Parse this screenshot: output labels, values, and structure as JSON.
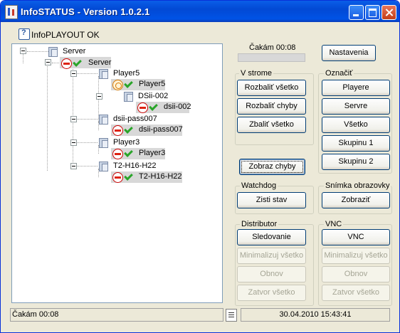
{
  "window": {
    "title": "InfoSTATUS - Version 1.0.2.1"
  },
  "playout_status": "InfoPLAYOUT OK",
  "tree": [
    {
      "label": "Server",
      "kind": "group"
    },
    {
      "label": "Server",
      "kind": "item",
      "status": "ok"
    },
    {
      "label": "Player5",
      "kind": "group"
    },
    {
      "label": "Player5",
      "kind": "item",
      "status": "warning"
    },
    {
      "label": "DSii-002",
      "kind": "group"
    },
    {
      "label": "dsii-002",
      "kind": "item",
      "status": "ok"
    },
    {
      "label": "dsii-pass007",
      "kind": "group"
    },
    {
      "label": "dsii-pass007",
      "kind": "item",
      "status": "ok"
    },
    {
      "label": "Player3",
      "kind": "group"
    },
    {
      "label": "Player3",
      "kind": "item",
      "status": "ok"
    },
    {
      "label": "T2-H16-H22",
      "kind": "group"
    },
    {
      "label": "T2-H16-H22",
      "kind": "item",
      "status": "ok"
    }
  ],
  "wait_label_top": "Čakám 00:08",
  "buttons": {
    "settings": "Nastavenia",
    "show_errors": "Zobraz chyby"
  },
  "groups": {
    "tree": {
      "title": "V strome",
      "buttons": [
        "Rozbaliť všetko",
        "Rozbaliť chyby",
        "Zbaliť všetko"
      ]
    },
    "mark": {
      "title": "Označiť",
      "buttons": [
        "Playere",
        "Servre",
        "Všetko",
        "Skupinu 1",
        "Skupinu 2"
      ]
    },
    "watchdog": {
      "title": "Watchdog",
      "buttons": [
        "Zisti stav"
      ]
    },
    "screenshot": {
      "title": "Snímka obrazovky",
      "buttons": [
        "Zobraziť"
      ]
    },
    "distributor": {
      "title": "Distributor",
      "buttons": [
        "Sledovanie",
        "Minimalizuj všetko",
        "Obnov",
        "Zatvor všetko"
      ]
    },
    "vnc": {
      "title": "VNC",
      "buttons": [
        "VNC",
        "Minimalizuj všetko",
        "Obnov",
        "Zatvor všetko"
      ]
    }
  },
  "statusbar": {
    "left": "Čakám 00:08",
    "right": "30.04.2010  15:43:41"
  }
}
